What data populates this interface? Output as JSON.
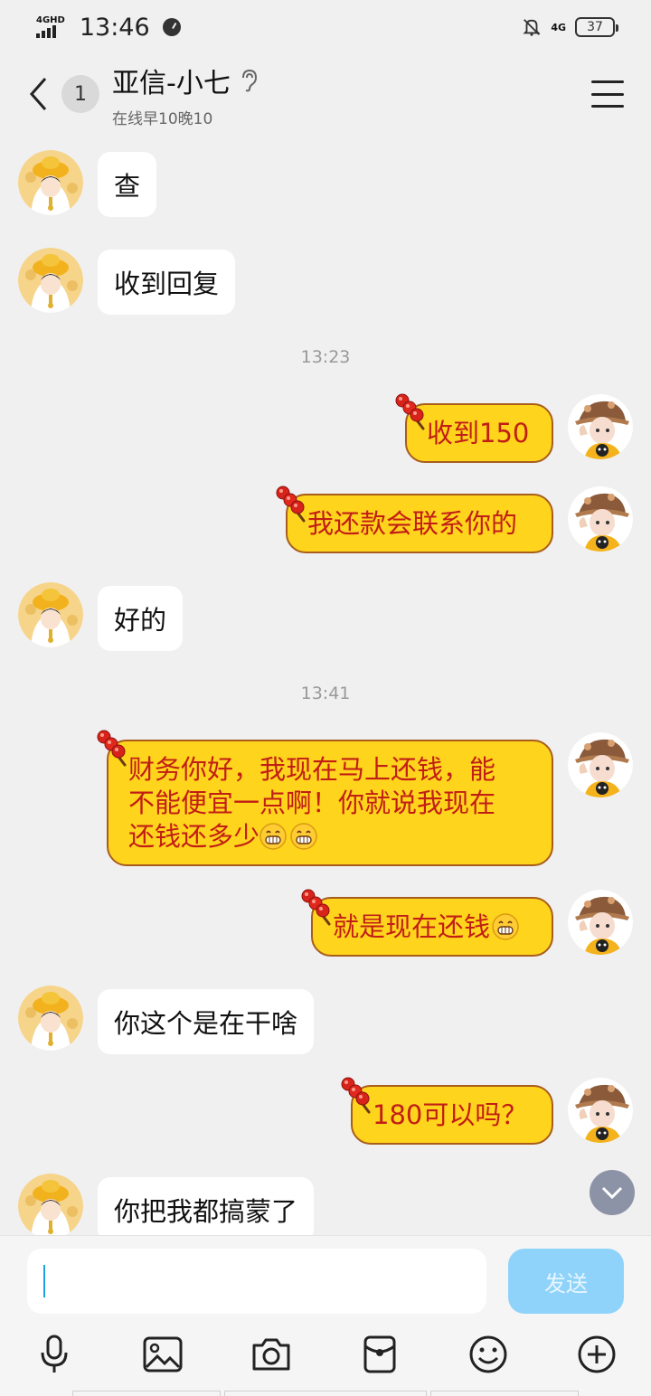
{
  "status_bar": {
    "network_label": "4GHD",
    "time": "13:46",
    "network_right": "4G",
    "battery": "37"
  },
  "header": {
    "unread_count": "1",
    "title": "亚信-小七",
    "subtitle": "在线早10晚10"
  },
  "messages": {
    "m1": "查",
    "m2": "收到回复",
    "t1": "13:23",
    "m3": "收到150",
    "m4": "我还款会联系你的",
    "m5": "好的",
    "t2": "13:41",
    "m6_line1": "财务你好，我现在马上还钱，能",
    "m6_line2": "不能便宜一点啊！你就说我现在",
    "m6_line3": "还钱还多少",
    "m7": "就是现在还钱",
    "m8": "你这个是在干啥",
    "m9": "180可以吗？",
    "m10": "你把我都搞蒙了"
  },
  "input": {
    "send_label": "发送"
  },
  "colors": {
    "incoming_bubble": "#ffffff",
    "outgoing_bubble": "#ffd41c",
    "outgoing_text": "#c11e16",
    "send_button": "#8fd3fb"
  },
  "icons": {
    "toolbar": [
      "mic-icon",
      "image-icon",
      "camera-icon",
      "red-packet-icon",
      "emoji-icon",
      "plus-icon"
    ]
  }
}
